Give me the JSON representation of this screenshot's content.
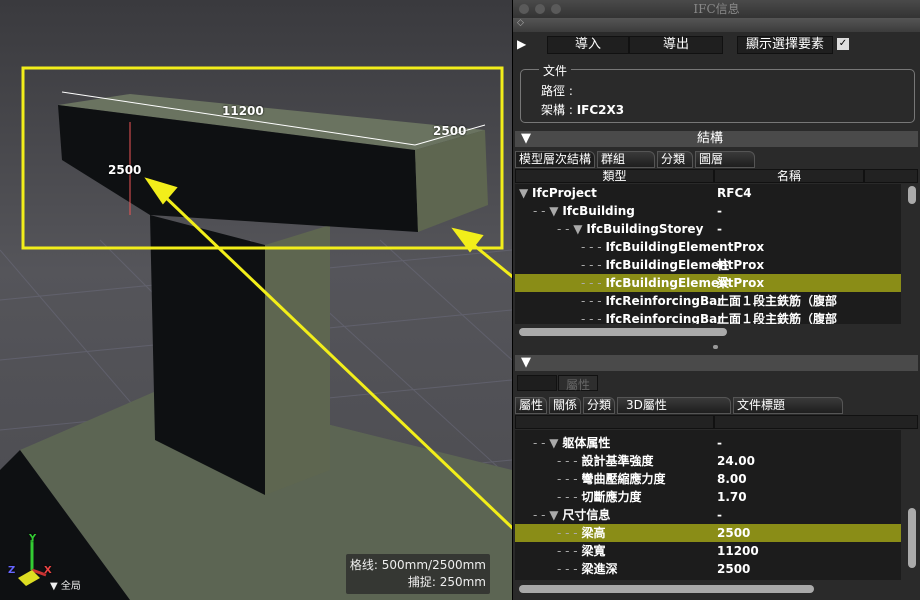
{
  "viewport": {
    "dimensions": {
      "length": "11200",
      "height": "2500",
      "depth": "2500"
    },
    "status": {
      "grid": "格线: 500mm/2500mm",
      "snap": "捕捉: 250mm"
    },
    "view_label": "全局",
    "axes": {
      "x": "X",
      "y": "Y",
      "z": "Z"
    },
    "highlight_color": "#f2ee1a"
  },
  "panel": {
    "title": "IFC信息",
    "import_label": "導入",
    "export_label": "導出",
    "show_selected_label": "顯示選擇要素",
    "show_selected_checked": true,
    "file": {
      "legend": "文件",
      "path_label": "路徑 :",
      "schema_label": "架構 :",
      "schema_value": "IFC2X3"
    },
    "structure": {
      "title": "結構",
      "tabs": [
        "模型層次結構",
        "群組",
        "分類",
        "圖層"
      ],
      "columns": [
        "類型",
        "名稱"
      ],
      "rows": [
        {
          "type": "IfcProject",
          "name": "RFC4",
          "level": 0,
          "expand": true
        },
        {
          "type": "IfcBuilding",
          "name": "-",
          "level": 1,
          "expand": true
        },
        {
          "type": "IfcBuildingStorey",
          "name": "-",
          "level": 2,
          "expand": true
        },
        {
          "type": "IfcBuildingElementProx",
          "name": "",
          "level": 3
        },
        {
          "type": "IfcBuildingElementProx",
          "name": "柱",
          "level": 3
        },
        {
          "type": "IfcBuildingElementProx",
          "name": "梁",
          "level": 3,
          "selected": true
        },
        {
          "type": "IfcReinforcingBar",
          "name": "上面１段主鉄筋（腹部",
          "level": 3
        },
        {
          "type": "IfcReinforcingBar",
          "name": "上面１段主鉄筋（腹部",
          "level": 3
        }
      ]
    },
    "properties": {
      "dropdown_label": "屬性",
      "tabs": [
        "屬性",
        "關係",
        "分類",
        "3D屬性",
        "文件標題"
      ],
      "rows": [
        {
          "name": "躯体属性",
          "value": "-",
          "level": 1,
          "expand": true
        },
        {
          "name": "設計基準強度",
          "value": "24.00",
          "level": 2
        },
        {
          "name": "彎曲壓縮應力度",
          "value": "8.00",
          "level": 2
        },
        {
          "name": "切斷應力度",
          "value": "1.70",
          "level": 2
        },
        {
          "name": "尺寸信息",
          "value": "-",
          "level": 1,
          "expand": true
        },
        {
          "name": "梁高",
          "value": "2500",
          "level": 2,
          "selected": true
        },
        {
          "name": "梁寬",
          "value": "11200",
          "level": 2
        },
        {
          "name": "梁進深",
          "value": "2500",
          "level": 2
        }
      ]
    }
  }
}
